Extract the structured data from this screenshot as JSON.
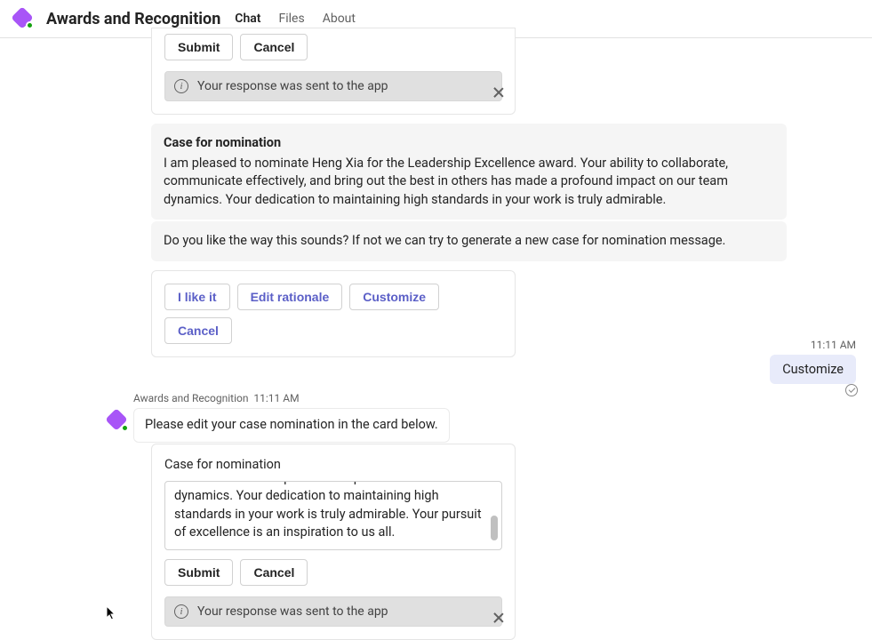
{
  "header": {
    "title": "Awards and Recognition",
    "tabs": [
      {
        "label": "Chat",
        "active": true
      },
      {
        "label": "Files",
        "active": false
      },
      {
        "label": "About",
        "active": false
      }
    ]
  },
  "card1": {
    "submit": "Submit",
    "cancel": "Cancel",
    "toast": "Your response was sent to the app"
  },
  "nomination_bubble": {
    "title": "Case for nomination",
    "body": "I am pleased to nominate Heng Xia for the Leadership Excellence award. Your ability to collaborate, communicate effectively, and bring out the best in others has made a profound impact on our team dynamics. Your dedication to maintaining high standards in your work is truly admirable."
  },
  "followup_bubble": {
    "text": "Do you like the way this sounds? If not we can try to generate a new case for nomination message."
  },
  "choice_card": {
    "like": "I like it",
    "edit": "Edit rationale",
    "customize": "Customize",
    "cancel": "Cancel"
  },
  "user_msg": {
    "time": "11:11 AM",
    "text": "Customize"
  },
  "bot2": {
    "sender": "Awards and Recognition",
    "time": "11:11 AM",
    "prompt": "Please edit your case nomination in the card below."
  },
  "edit_card": {
    "title": "Case for nomination",
    "textarea_visible": "communicate effectively, and bring out the best in others has made a profound impact on our team dynamics. Your dedication to maintaining high standards in your work is truly admirable. Your pursuit of excellence is an inspiration to us all.",
    "submit": "Submit",
    "cancel": "Cancel",
    "toast": "Your response was sent to the app"
  }
}
